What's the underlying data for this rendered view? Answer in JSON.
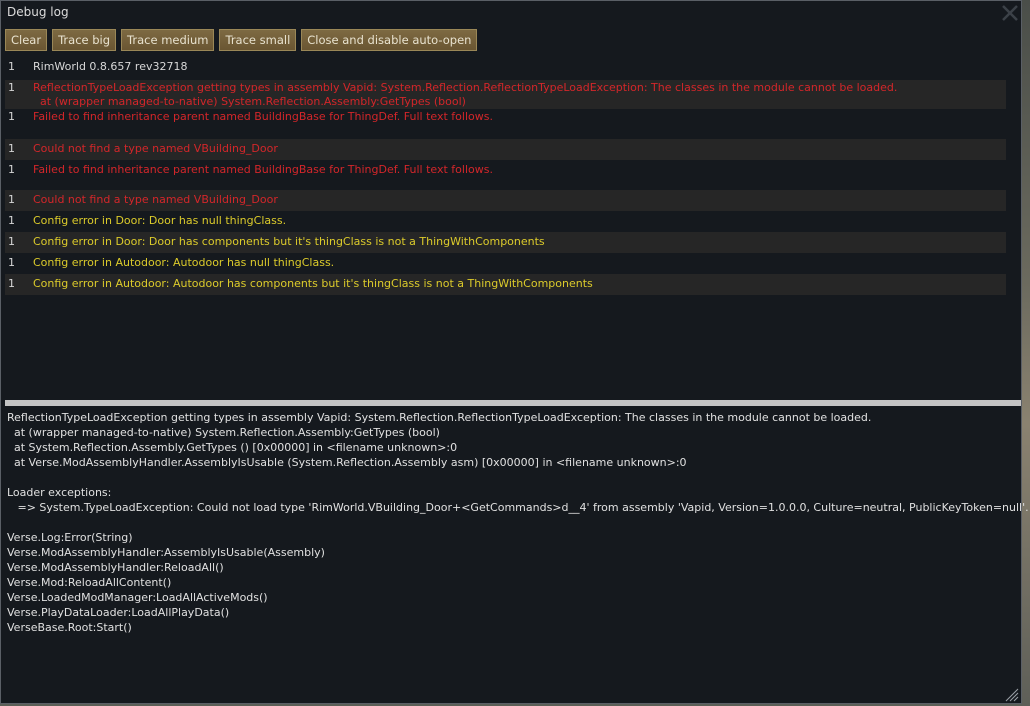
{
  "window": {
    "title": "Debug log"
  },
  "toolbar": {
    "buttons": [
      {
        "label": "Clear"
      },
      {
        "label": "Trace big"
      },
      {
        "label": "Trace medium"
      },
      {
        "label": "Trace small"
      },
      {
        "label": "Close and disable auto-open"
      }
    ]
  },
  "log": {
    "entries": [
      {
        "count": "1",
        "severity": "info",
        "lines": [
          "RimWorld 0.8.657 rev32718"
        ]
      },
      {
        "count": "1",
        "severity": "error",
        "lines": [
          "ReflectionTypeLoadException getting types in assembly Vapid: System.Reflection.ReflectionTypeLoadException: The classes in the module cannot be loaded.",
          "  at (wrapper managed-to-native) System.Reflection.Assembly:GetTypes (bool)"
        ]
      },
      {
        "count": "1",
        "severity": "error",
        "lines": [
          "Failed to find inheritance parent named BuildingBase for ThingDef. Full text follows."
        ]
      },
      {
        "count": "1",
        "severity": "error",
        "lines": [
          "Could not find a type named VBuilding_Door"
        ]
      },
      {
        "count": "1",
        "severity": "error",
        "lines": [
          "Failed to find inheritance parent named BuildingBase for ThingDef. Full text follows."
        ]
      },
      {
        "count": "1",
        "severity": "error",
        "lines": [
          "Could not find a type named VBuilding_Door"
        ]
      },
      {
        "count": "1",
        "severity": "warning",
        "lines": [
          "Config error in Door: Door has null thingClass."
        ]
      },
      {
        "count": "1",
        "severity": "warning",
        "lines": [
          "Config error in Door: Door has components but it's thingClass is not a ThingWithComponents"
        ]
      },
      {
        "count": "1",
        "severity": "warning",
        "lines": [
          "Config error in Autodoor: Autodoor has null thingClass."
        ]
      },
      {
        "count": "1",
        "severity": "warning",
        "lines": [
          "Config error in Autodoor: Autodoor has components but it's thingClass is not a ThingWithComponents"
        ]
      }
    ]
  },
  "detail": {
    "lines": [
      "ReflectionTypeLoadException getting types in assembly Vapid: System.Reflection.ReflectionTypeLoadException: The classes in the module cannot be loaded.",
      "  at (wrapper managed-to-native) System.Reflection.Assembly:GetTypes (bool)",
      "  at System.Reflection.Assembly.GetTypes () [0x00000] in <filename unknown>:0",
      "  at Verse.ModAssemblyHandler.AssemblyIsUsable (System.Reflection.Assembly asm) [0x00000] in <filename unknown>:0",
      "",
      "Loader exceptions:",
      "   => System.TypeLoadException: Could not load type 'RimWorld.VBuilding_Door+<GetCommands>d__4' from assembly 'Vapid, Version=1.0.0.0, Culture=neutral, PublicKeyToken=null'.",
      "",
      "Verse.Log:Error(String)",
      "Verse.ModAssemblyHandler:AssemblyIsUsable(Assembly)",
      "Verse.ModAssemblyHandler:ReloadAll()",
      "Verse.Mod:ReloadAllContent()",
      "Verse.LoadedModManager:LoadAllActiveMods()",
      "Verse.PlayDataLoader:LoadAllPlayData()",
      "VerseBase.Root:Start()"
    ]
  },
  "icons": {
    "close": "close-icon",
    "resize": "resize-handle-icon"
  },
  "colors": {
    "window_bg": "#15191e",
    "button_bg": "#6f5b35",
    "error": "#d3262a",
    "warning": "#dccb2b",
    "info": "#d8d8d8",
    "row_highlight": "#262626"
  }
}
